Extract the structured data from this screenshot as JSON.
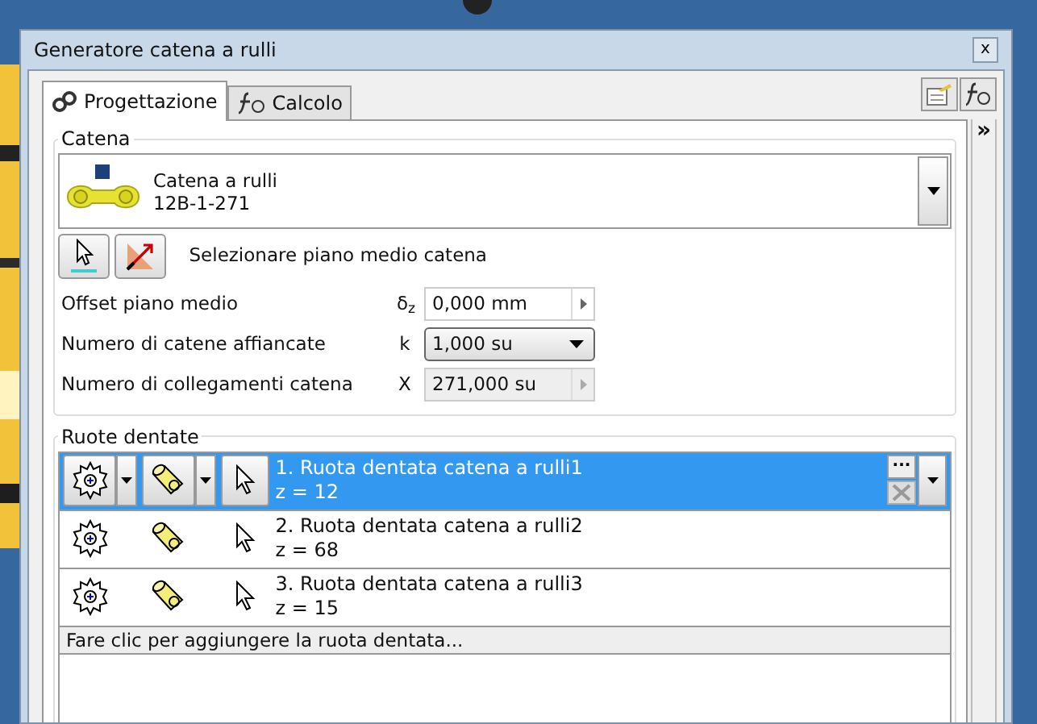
{
  "window": {
    "title": "Generatore catena a rulli",
    "close": "x"
  },
  "tabs": [
    {
      "label": "Progettazione",
      "selected": true
    },
    {
      "label": "Calcolo",
      "selected": false
    }
  ],
  "chain_group": {
    "legend": "Catena",
    "name": "Catena a rulli",
    "code": "12B-1-271",
    "plane_label": "Selezionare piano medio catena"
  },
  "fields": [
    {
      "label": "Offset piano medio",
      "symbol": "δ$_{z}$",
      "value": "0,000 mm",
      "kind": "spin",
      "disabled": false
    },
    {
      "label": "Numero di catene affiancate",
      "symbol": "k",
      "value": "1,000 su",
      "kind": "dropdown",
      "disabled": false
    },
    {
      "label": "Numero di collegamenti catena",
      "symbol": "X",
      "value": "271,000 su",
      "kind": "spin",
      "disabled": true
    }
  ],
  "sprockets_group": {
    "legend": "Ruote dentate",
    "more_button": "...",
    "add_row": "Fare clic per aggiungere la ruota dentata...",
    "rows": [
      {
        "title": "1. Ruota dentata catena a rulli1",
        "teeth": "z = 12",
        "selected": true
      },
      {
        "title": "2. Ruota dentata catena a rulli2",
        "teeth": "z = 68",
        "selected": false
      },
      {
        "title": "3. Ruota dentata catena a rulli3",
        "teeth": "z = 15",
        "selected": false
      }
    ]
  },
  "side_panel": {
    "expand": "»"
  }
}
